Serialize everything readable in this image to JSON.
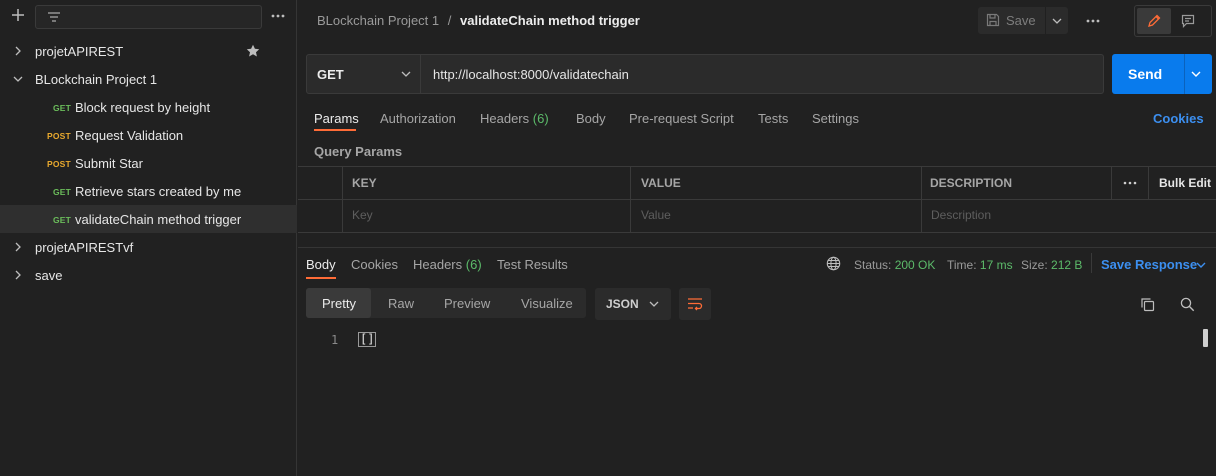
{
  "sidebar": {
    "collections": [
      {
        "label": "projetAPIREST",
        "expanded": false,
        "starred": true
      },
      {
        "label": "BLockchain Project 1",
        "expanded": true,
        "requests": [
          {
            "method": "GET",
            "label": "Block request by height"
          },
          {
            "method": "POST",
            "label": "Request Validation"
          },
          {
            "method": "POST",
            "label": "Submit Star"
          },
          {
            "method": "GET",
            "label": "Retrieve stars created by me"
          },
          {
            "method": "GET",
            "label": "validateChain method trigger",
            "active": true
          }
        ]
      },
      {
        "label": "projetAPIRESTvf",
        "expanded": false
      },
      {
        "label": "save",
        "expanded": false
      }
    ]
  },
  "header": {
    "breadcrumb_collection": "BLockchain Project 1",
    "breadcrumb_sep": "/",
    "request_name": "validateChain method trigger",
    "save_label": "Save"
  },
  "request": {
    "method": "GET",
    "url": "http://localhost:8000/validatechain",
    "send_label": "Send"
  },
  "request_tabs": {
    "params": "Params",
    "authorization": "Authorization",
    "headers": "Headers",
    "headers_count": "(6)",
    "body": "Body",
    "prerequest": "Pre-request Script",
    "tests": "Tests",
    "settings": "Settings",
    "cookies": "Cookies"
  },
  "params": {
    "section_title": "Query Params",
    "columns": [
      "KEY",
      "VALUE",
      "DESCRIPTION"
    ],
    "bulk_edit": "Bulk Edit",
    "placeholders": {
      "key": "Key",
      "value": "Value",
      "description": "Description"
    }
  },
  "response": {
    "tabs": {
      "body": "Body",
      "cookies": "Cookies",
      "headers": "Headers",
      "headers_count": "(6)",
      "test_results": "Test Results"
    },
    "status_label": "Status:",
    "status_value": "200 OK",
    "time_label": "Time:",
    "time_value": "17 ms",
    "size_label": "Size:",
    "size_value": "212 B",
    "save_response": "Save Response",
    "view_modes": {
      "pretty": "Pretty",
      "raw": "Raw",
      "preview": "Preview",
      "visualize": "Visualize"
    },
    "format": "JSON",
    "line_number": "1",
    "content": "[]"
  },
  "colors": {
    "accent_orange": "#ff6c37",
    "send_blue": "#097bed",
    "status_green": "#5cbb6a",
    "link_blue": "#3c8ff0",
    "get_green": "#6bbd5b",
    "post_yellow": "#e9a92e"
  }
}
